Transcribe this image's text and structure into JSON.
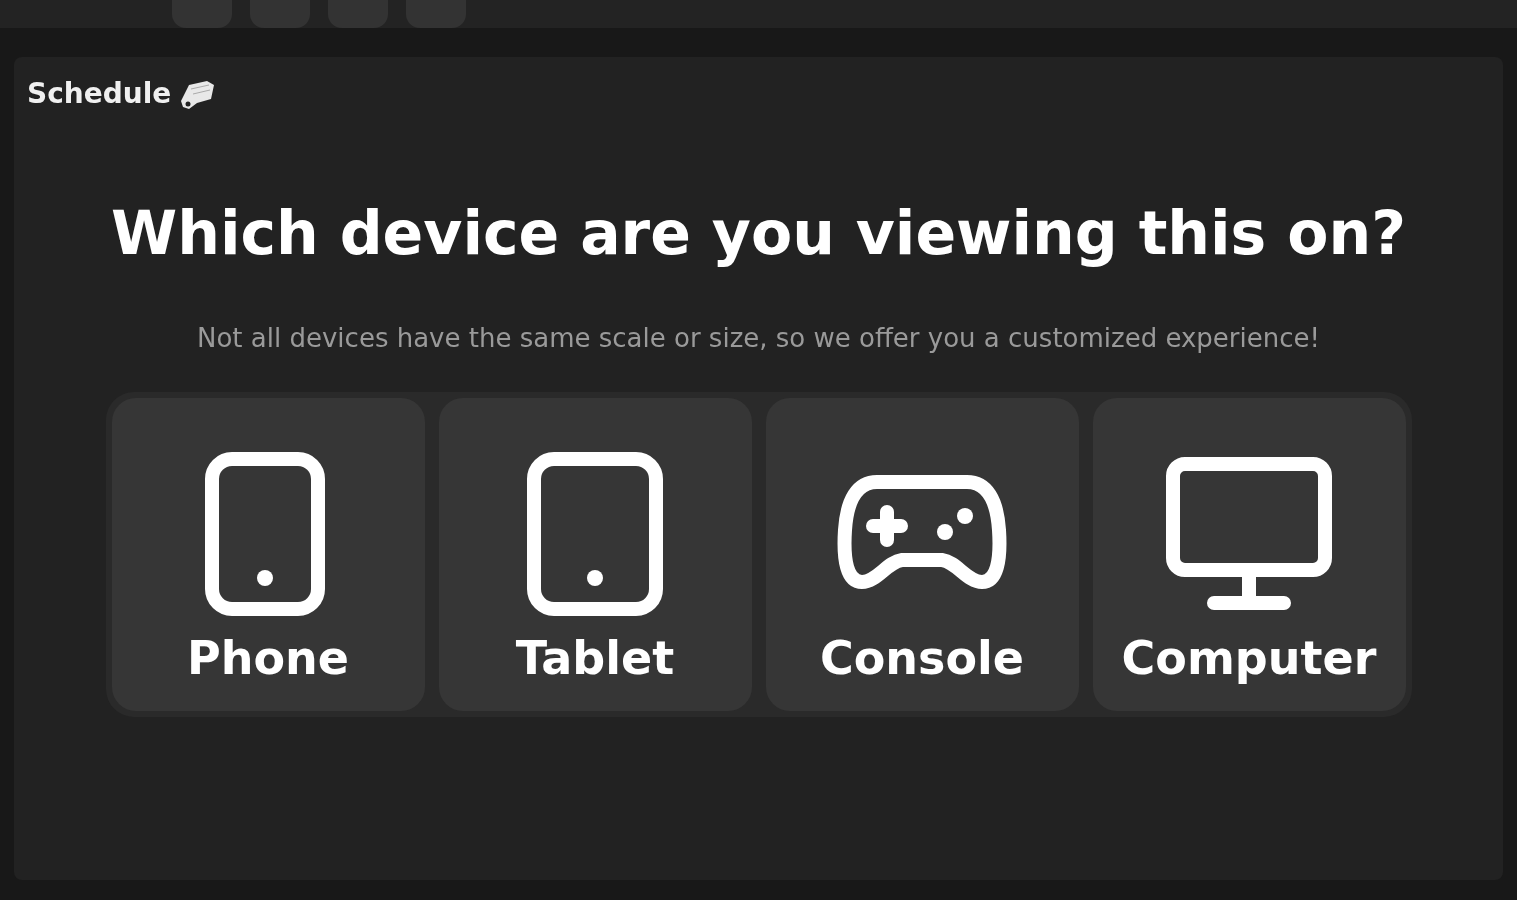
{
  "header": {
    "title": "Schedule"
  },
  "prompt": {
    "heading": "Which device are you viewing this on?",
    "subtitle": "Not all devices have the same scale or size, so we offer you a customized experience!"
  },
  "devices": [
    {
      "kind": "phone",
      "label": "Phone"
    },
    {
      "kind": "tablet",
      "label": "Tablet"
    },
    {
      "kind": "console",
      "label": "Console"
    },
    {
      "kind": "computer",
      "label": "Computer"
    }
  ]
}
